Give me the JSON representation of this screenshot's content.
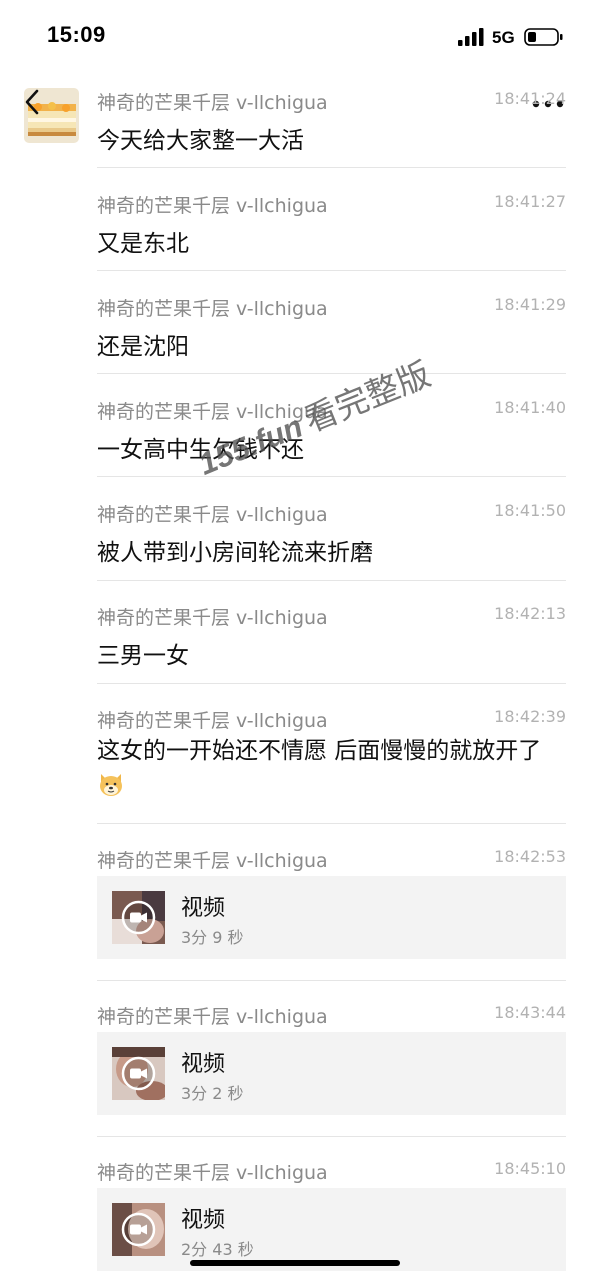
{
  "status_bar": {
    "time": "15:09",
    "network": "5G",
    "signal_icon": "cellular-signal-icon",
    "battery_icon": "battery-low-icon"
  },
  "nav": {
    "back_icon": "chevron-left-icon",
    "more_icon": "more-dots-icon"
  },
  "messages": [
    {
      "sender": "神奇的芒果千层 v-llchigua",
      "time": "18:41:24",
      "text": "今天给大家整一大活"
    },
    {
      "sender": "神奇的芒果千层 v-llchigua",
      "time": "18:41:27",
      "text": "又是东北"
    },
    {
      "sender": "神奇的芒果千层 v-llchigua",
      "time": "18:41:29",
      "text": "还是沈阳"
    },
    {
      "sender": "神奇的芒果千层 v-llchigua",
      "time": "18:41:40",
      "text": "一女高中生欠钱不还"
    },
    {
      "sender": "神奇的芒果千层 v-llchigua",
      "time": "18:41:50",
      "text": "被人带到小房间轮流来折磨"
    },
    {
      "sender": "神奇的芒果千层 v-llchigua",
      "time": "18:42:13",
      "text": "三男一女"
    },
    {
      "sender": "神奇的芒果千层 v-llchigua",
      "time": "18:42:39",
      "text": "这女的一开始还不情愿 后面慢慢的就放开了",
      "emoji": "doge-emoji-icon"
    },
    {
      "sender": "神奇的芒果千层 v-llchigua",
      "time": "18:42:53",
      "video": {
        "title": "视频",
        "duration": "3分 9 秒"
      }
    },
    {
      "sender": "神奇的芒果千层 v-llchigua",
      "time": "18:43:44",
      "video": {
        "title": "视频",
        "duration": "3分 2 秒"
      }
    },
    {
      "sender": "神奇的芒果千层 v-llchigua",
      "time": "18:45:10",
      "video": {
        "title": "视频",
        "duration": "2分 43 秒"
      }
    }
  ],
  "watermark": {
    "url": "155.fun",
    "text": "看完整版"
  },
  "colors": {
    "sender": "#8a8a8a",
    "timestamp": "#b2b2b2",
    "divider": "#e5e5e5",
    "video_card_bg": "#f3f3f3"
  }
}
